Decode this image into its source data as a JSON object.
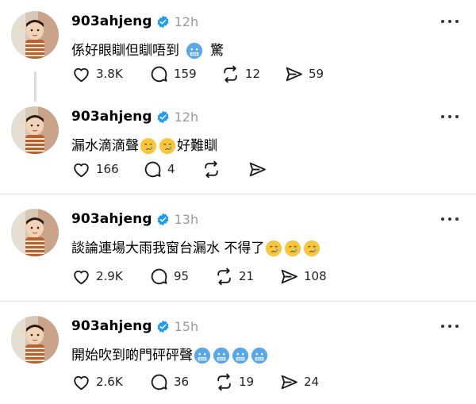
{
  "posts": [
    {
      "username": "903ahjeng",
      "time": "12h",
      "text_before": "係好眼瞓但瞓唔到",
      "emoji_after": [
        "cold-face"
      ],
      "text_after": "驚",
      "likes": "3.8K",
      "replies": "159",
      "reposts": "12",
      "shares": "59"
    },
    {
      "username": "903ahjeng",
      "time": "12h",
      "text_before": "漏水滴滴聲",
      "emoji_after": [
        "crying-face",
        "crying-face"
      ],
      "text_after": "好難瞓",
      "likes": "166",
      "replies": "4",
      "reposts": "",
      "shares": ""
    },
    {
      "username": "903ahjeng",
      "time": "13h",
      "text_before": "談論連場大雨我窗台漏水 不得了",
      "emoji_after": [
        "crying-face",
        "crying-face",
        "crying-face"
      ],
      "text_after": "",
      "likes": "2.9K",
      "replies": "95",
      "reposts": "21",
      "shares": "108"
    },
    {
      "username": "903ahjeng",
      "time": "15h",
      "text_before": "開始吹到啲門砰砰聲",
      "emoji_after": [
        "cold-face",
        "cold-face",
        "cold-face",
        "cold-face"
      ],
      "text_after": "",
      "likes": "2.6K",
      "replies": "36",
      "reposts": "19",
      "shares": "24"
    }
  ],
  "colors": {
    "verified": "#1d9bf0",
    "muted": "#9a9a9a"
  }
}
